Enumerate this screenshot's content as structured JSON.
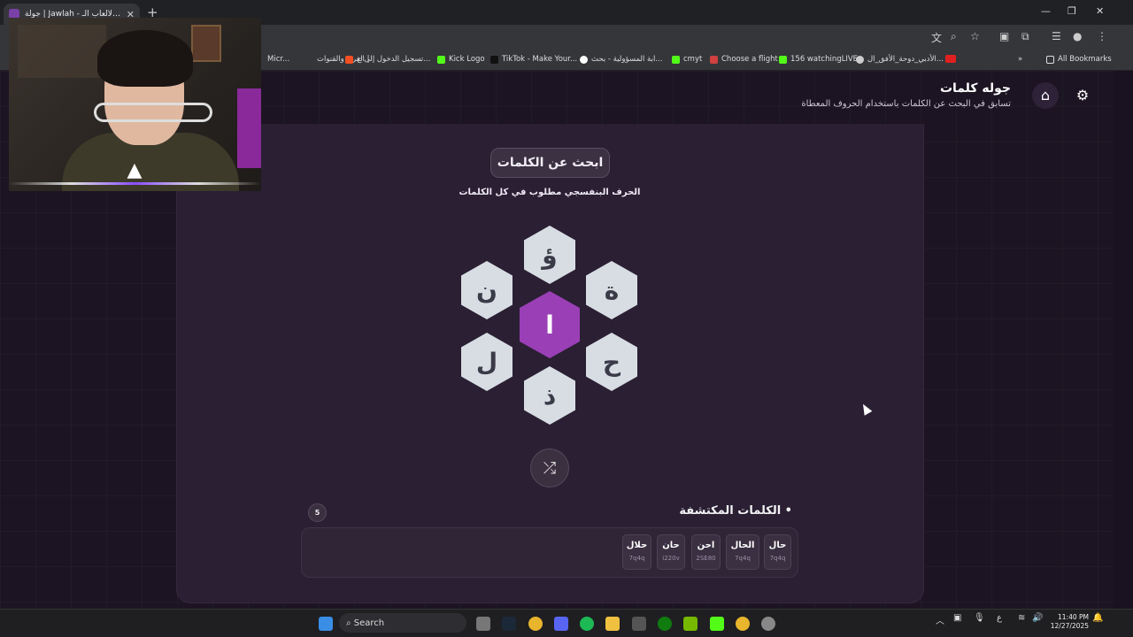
{
  "browser": {
    "tab_title": "جولة | Jawlah - منصة الألعاب الـ...",
    "bookmarks": [
      {
        "label": "Micr...",
        "color": "#5b6f8a"
      },
      {
        "label": "الفرق والقنوات |",
        "color": "#5b6f8a"
      },
      {
        "label": "تسجيل الدخول إلى ح...",
        "color": "#f25022"
      },
      {
        "label": "Kick Logo",
        "color": "#53fc18"
      },
      {
        "label": "TikTok - Make Your...",
        "color": "#111111"
      },
      {
        "label": "ابة المسؤولية - بحث...",
        "color": "#ffffff"
      },
      {
        "label": "cmyt",
        "color": "#53fc18"
      },
      {
        "label": "Choose a flight",
        "color": "#d04040"
      },
      {
        "label": "156 watchingLIVE",
        "color": "#53fc18"
      },
      {
        "label": "الأدبي_دوحة_الأفق_ال...",
        "color": "#cccccc"
      }
    ],
    "all_bookmarks": "All Bookmarks"
  },
  "header": {
    "title": "جوله كلمات",
    "subtitle": "تسابق في البحث عن الكلمات باستخدام الحروف المعطاة"
  },
  "game": {
    "pill_label": "ابحث عن الكلمات",
    "hint": "الحرف البنفسجي مطلوب في كل الكلمات",
    "center_letter": "ا",
    "letters": {
      "top": "ؤ",
      "top_left": "ن",
      "top_right": "ة",
      "bottom_left": "ل",
      "bottom_right": "ح",
      "bottom": "ذ"
    },
    "found_title": "الكلمات المكتشفة",
    "found_count": "5",
    "found_words": [
      {
        "word": "حال",
        "user": "7q4q"
      },
      {
        "word": "الحال",
        "user": "7q4q"
      },
      {
        "word": "احن",
        "user": "2SE80"
      },
      {
        "word": "حان",
        "user": "i220v"
      },
      {
        "word": "حلال",
        "user": "7q4q"
      }
    ]
  },
  "taskbar": {
    "search_label": "Search",
    "time": "11:40 PM",
    "date": "12/27/2025",
    "lang": "ع"
  }
}
